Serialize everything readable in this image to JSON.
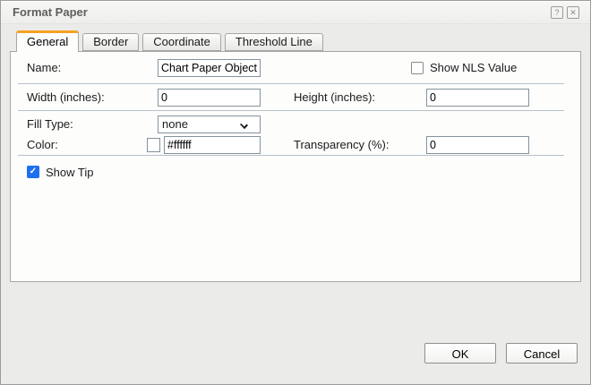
{
  "window": {
    "title": "Format Paper",
    "icons": {
      "help": "?",
      "close": "✕"
    }
  },
  "tabs": [
    {
      "label": "General",
      "active": true
    },
    {
      "label": "Border",
      "active": false
    },
    {
      "label": "Coordinate",
      "active": false
    },
    {
      "label": "Threshold Line",
      "active": false
    }
  ],
  "form": {
    "name": {
      "label": "Name:",
      "value": "Chart Paper Object"
    },
    "show_nls": {
      "label": "Show NLS Value",
      "checked": false
    },
    "width": {
      "label": "Width (inches):",
      "value": "0"
    },
    "height": {
      "label": "Height (inches):",
      "value": "0"
    },
    "fill_type": {
      "label": "Fill Type:",
      "value": "none"
    },
    "color": {
      "label": "Color:",
      "value": "#ffffff",
      "swatch_color": "#ffffff"
    },
    "transparency": {
      "label": "Transparency (%):",
      "value": "0"
    },
    "show_tip": {
      "label": "Show Tip",
      "checked": true
    }
  },
  "buttons": {
    "ok": "OK",
    "cancel": "Cancel"
  },
  "colors": {
    "active_tab_accent": "#f3a21f",
    "checked_checkbox_blue": "#1d70ee",
    "separator": "#b7c1c9",
    "dialog_background": "#ebebe9"
  }
}
